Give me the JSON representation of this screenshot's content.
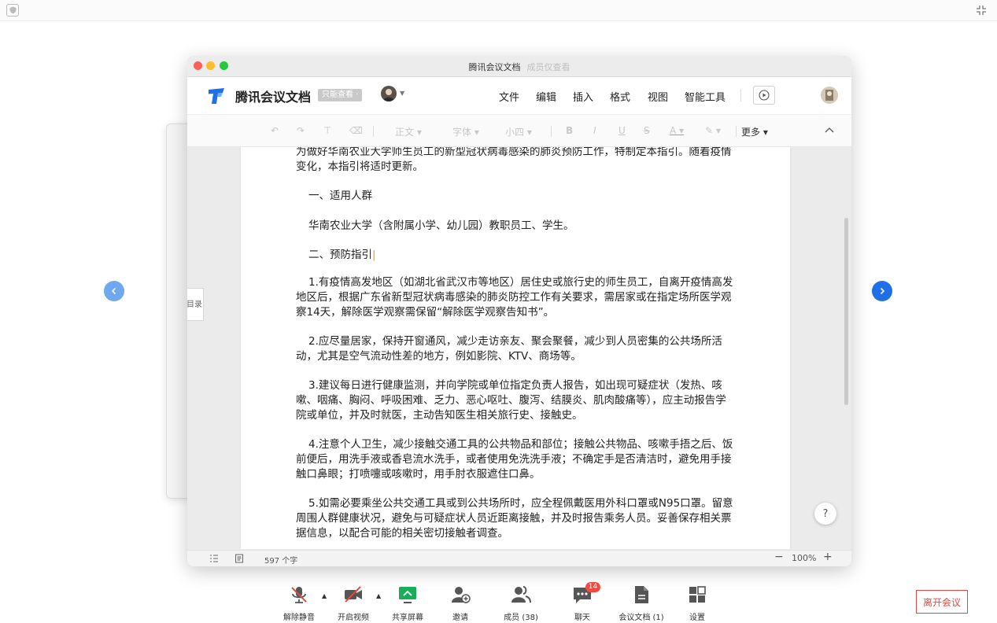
{
  "window": {
    "title": "腾讯会议文档",
    "subtitle": "成员仅查看"
  },
  "doc_header": {
    "app_name": "腾讯会议文档",
    "readonly_badge": "只能查看 ·",
    "menu": [
      "文件",
      "编辑",
      "插入",
      "格式",
      "视图",
      "智能工具"
    ]
  },
  "toolbar": {
    "style": "正文",
    "font": "字体",
    "size": "小四",
    "more": "更多"
  },
  "document": {
    "toc_label": "目录",
    "paragraphs": [
      "为做好华南农业大学师生员工的新型冠状病毒感染的肺炎预防工作，特制定本指引。随着疫情变化，本指引将适时更新。",
      "一、适用人群",
      "华南农业大学（含附属小学、幼儿园）教职员工、学生。",
      "二、预防指引",
      "1.有疫情高发地区（如湖北省武汉市等地区）居住史或旅行史的师生员工，自离开疫情高发地区后，根据广东省新型冠状病毒感染的肺炎防控工作有关要求，需居家或在指定场所医学观察14天，解除医学观察需保留“解除医学观察告知书”。",
      "2.应尽量居家，保持开窗通风，减少走访亲友、聚会聚餐，减少到人员密集的公共场所活动，尤其是空气流动性差的地方，例如影院、KTV、商场等。",
      "3.建议每日进行健康监测，并向学院或单位指定负责人报告，如出现可疑症状（发热、咳嗽、咽痛、胸闷、呼吸困难、乏力、恶心呕吐、腹泻、结膜炎、肌肉酸痛等），应主动报告学院或单位，并及时就医，主动告知医生相关旅行史、接触史。",
      "4.注意个人卫生，减少接触交通工具的公共物品和部位；接触公共物品、咳嗽手捂之后、饭前便后，用洗手液或香皂流水洗手，或者使用免洗洗手液；不确定手是否清洁时，避免用手接触口鼻眼；打喷嚏或咳嗽时，用手肘衣服遮住口鼻。",
      "5.如需必要乘坐公共交通工具或到公共场所时，应全程佩戴医用外科口罩或N95口罩。留意周围人群健康状况，避免与可疑症状人员近距离接触，并及时报告乘务人员。妥善保存相关票据信息，以配合可能的相关密切接触者调查。"
    ],
    "help": "?"
  },
  "statusbar": {
    "word_count": "597 个字",
    "zoom_minus": "−",
    "zoom": "100%",
    "zoom_plus": "+"
  },
  "meeting_bar": {
    "items": [
      {
        "label": "解除静音",
        "icon": "mic-muted-icon"
      },
      {
        "label": "开启视频",
        "icon": "camera-off-icon"
      },
      {
        "label": "共享屏幕",
        "icon": "share-screen-icon"
      },
      {
        "label": "邀请",
        "icon": "add-user-icon"
      },
      {
        "label": "成员 (38)",
        "icon": "members-icon"
      },
      {
        "label": "聊天",
        "icon": "chat-icon"
      },
      {
        "label": "会议文档 (1)",
        "icon": "document-icon"
      },
      {
        "label": "设置",
        "icon": "settings-grid-icon"
      }
    ],
    "chat_badge": "14",
    "leave": "离开会议"
  },
  "colors": {
    "accent_blue": "#1e6fe8",
    "leave_red": "#e14b3f",
    "share_green": "#1aad5a",
    "badge_red": "#f24a3d"
  }
}
